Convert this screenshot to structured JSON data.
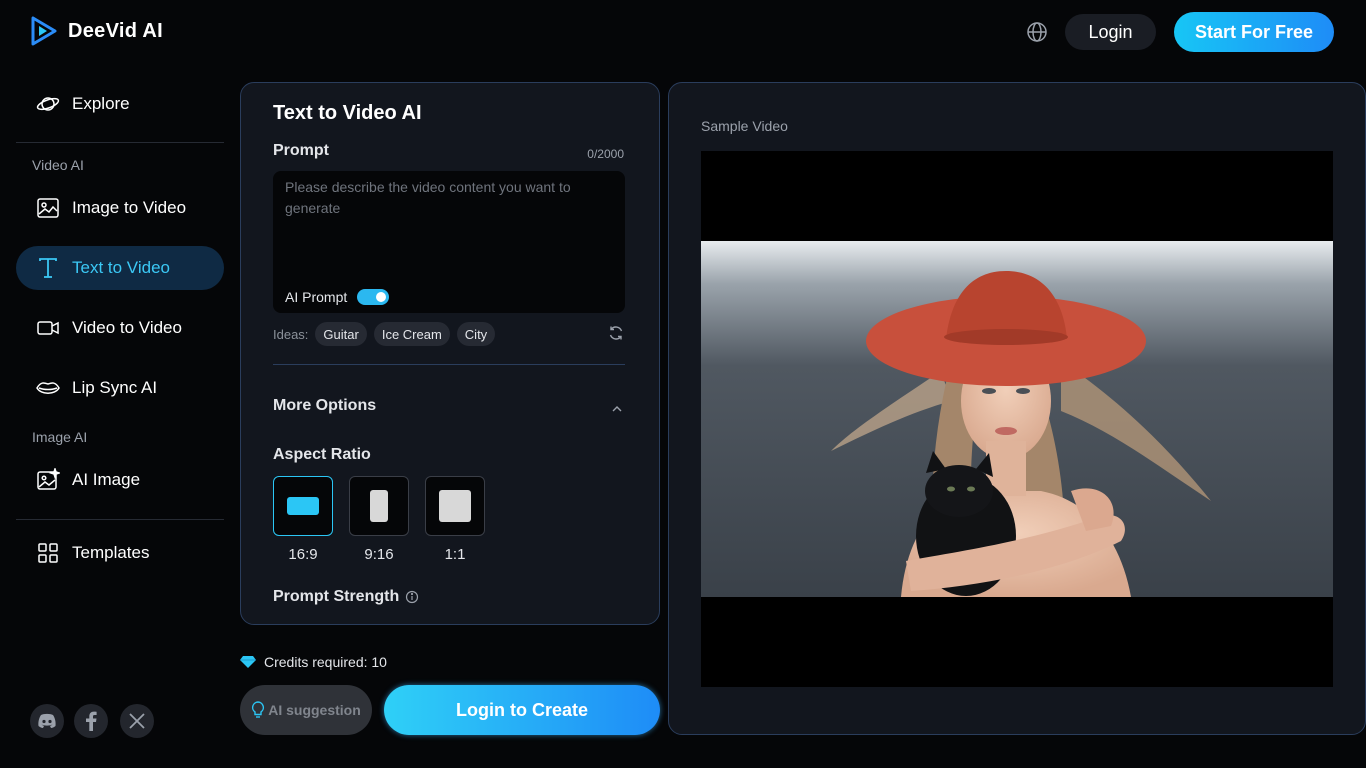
{
  "header": {
    "brand": "DeeVid AI",
    "login_label": "Login",
    "start_label": "Start For Free"
  },
  "sidebar": {
    "explore": "Explore",
    "section_video": "Video AI",
    "video_items": [
      {
        "label": "Image to Video",
        "icon": "image-icon"
      },
      {
        "label": "Text to Video",
        "icon": "text-icon",
        "active": true
      },
      {
        "label": "Video to Video",
        "icon": "video-camera-icon"
      },
      {
        "label": "Lip Sync AI",
        "icon": "lips-icon"
      }
    ],
    "section_image": "Image AI",
    "ai_image": "AI Image",
    "templates": "Templates",
    "socials": [
      "discord-icon",
      "facebook-icon",
      "x-icon"
    ]
  },
  "form": {
    "title": "Text to Video AI",
    "prompt_label": "Prompt",
    "prompt_count": "0/2000",
    "prompt_placeholder": "Please describe the video content you want to generate",
    "ai_prompt_label": "AI Prompt",
    "ai_prompt_on": true,
    "ideas_label": "Ideas:",
    "ideas": [
      "Guitar",
      "Ice Cream",
      "City"
    ],
    "more_options": "More Options",
    "aspect_ratio_label": "Aspect Ratio",
    "aspect_ratios": [
      "16:9",
      "9:16",
      "1:1"
    ],
    "aspect_selected": "16:9",
    "prompt_strength_label": "Prompt Strength"
  },
  "actions": {
    "credits": "Credits required: 10",
    "suggestion": "AI suggestion",
    "create": "Login to Create"
  },
  "preview": {
    "label": "Sample Video"
  },
  "colors": {
    "accent": "#2bc6f5",
    "active_nav_bg": "#0f2a44",
    "panel_border": "#2a3d5c"
  }
}
